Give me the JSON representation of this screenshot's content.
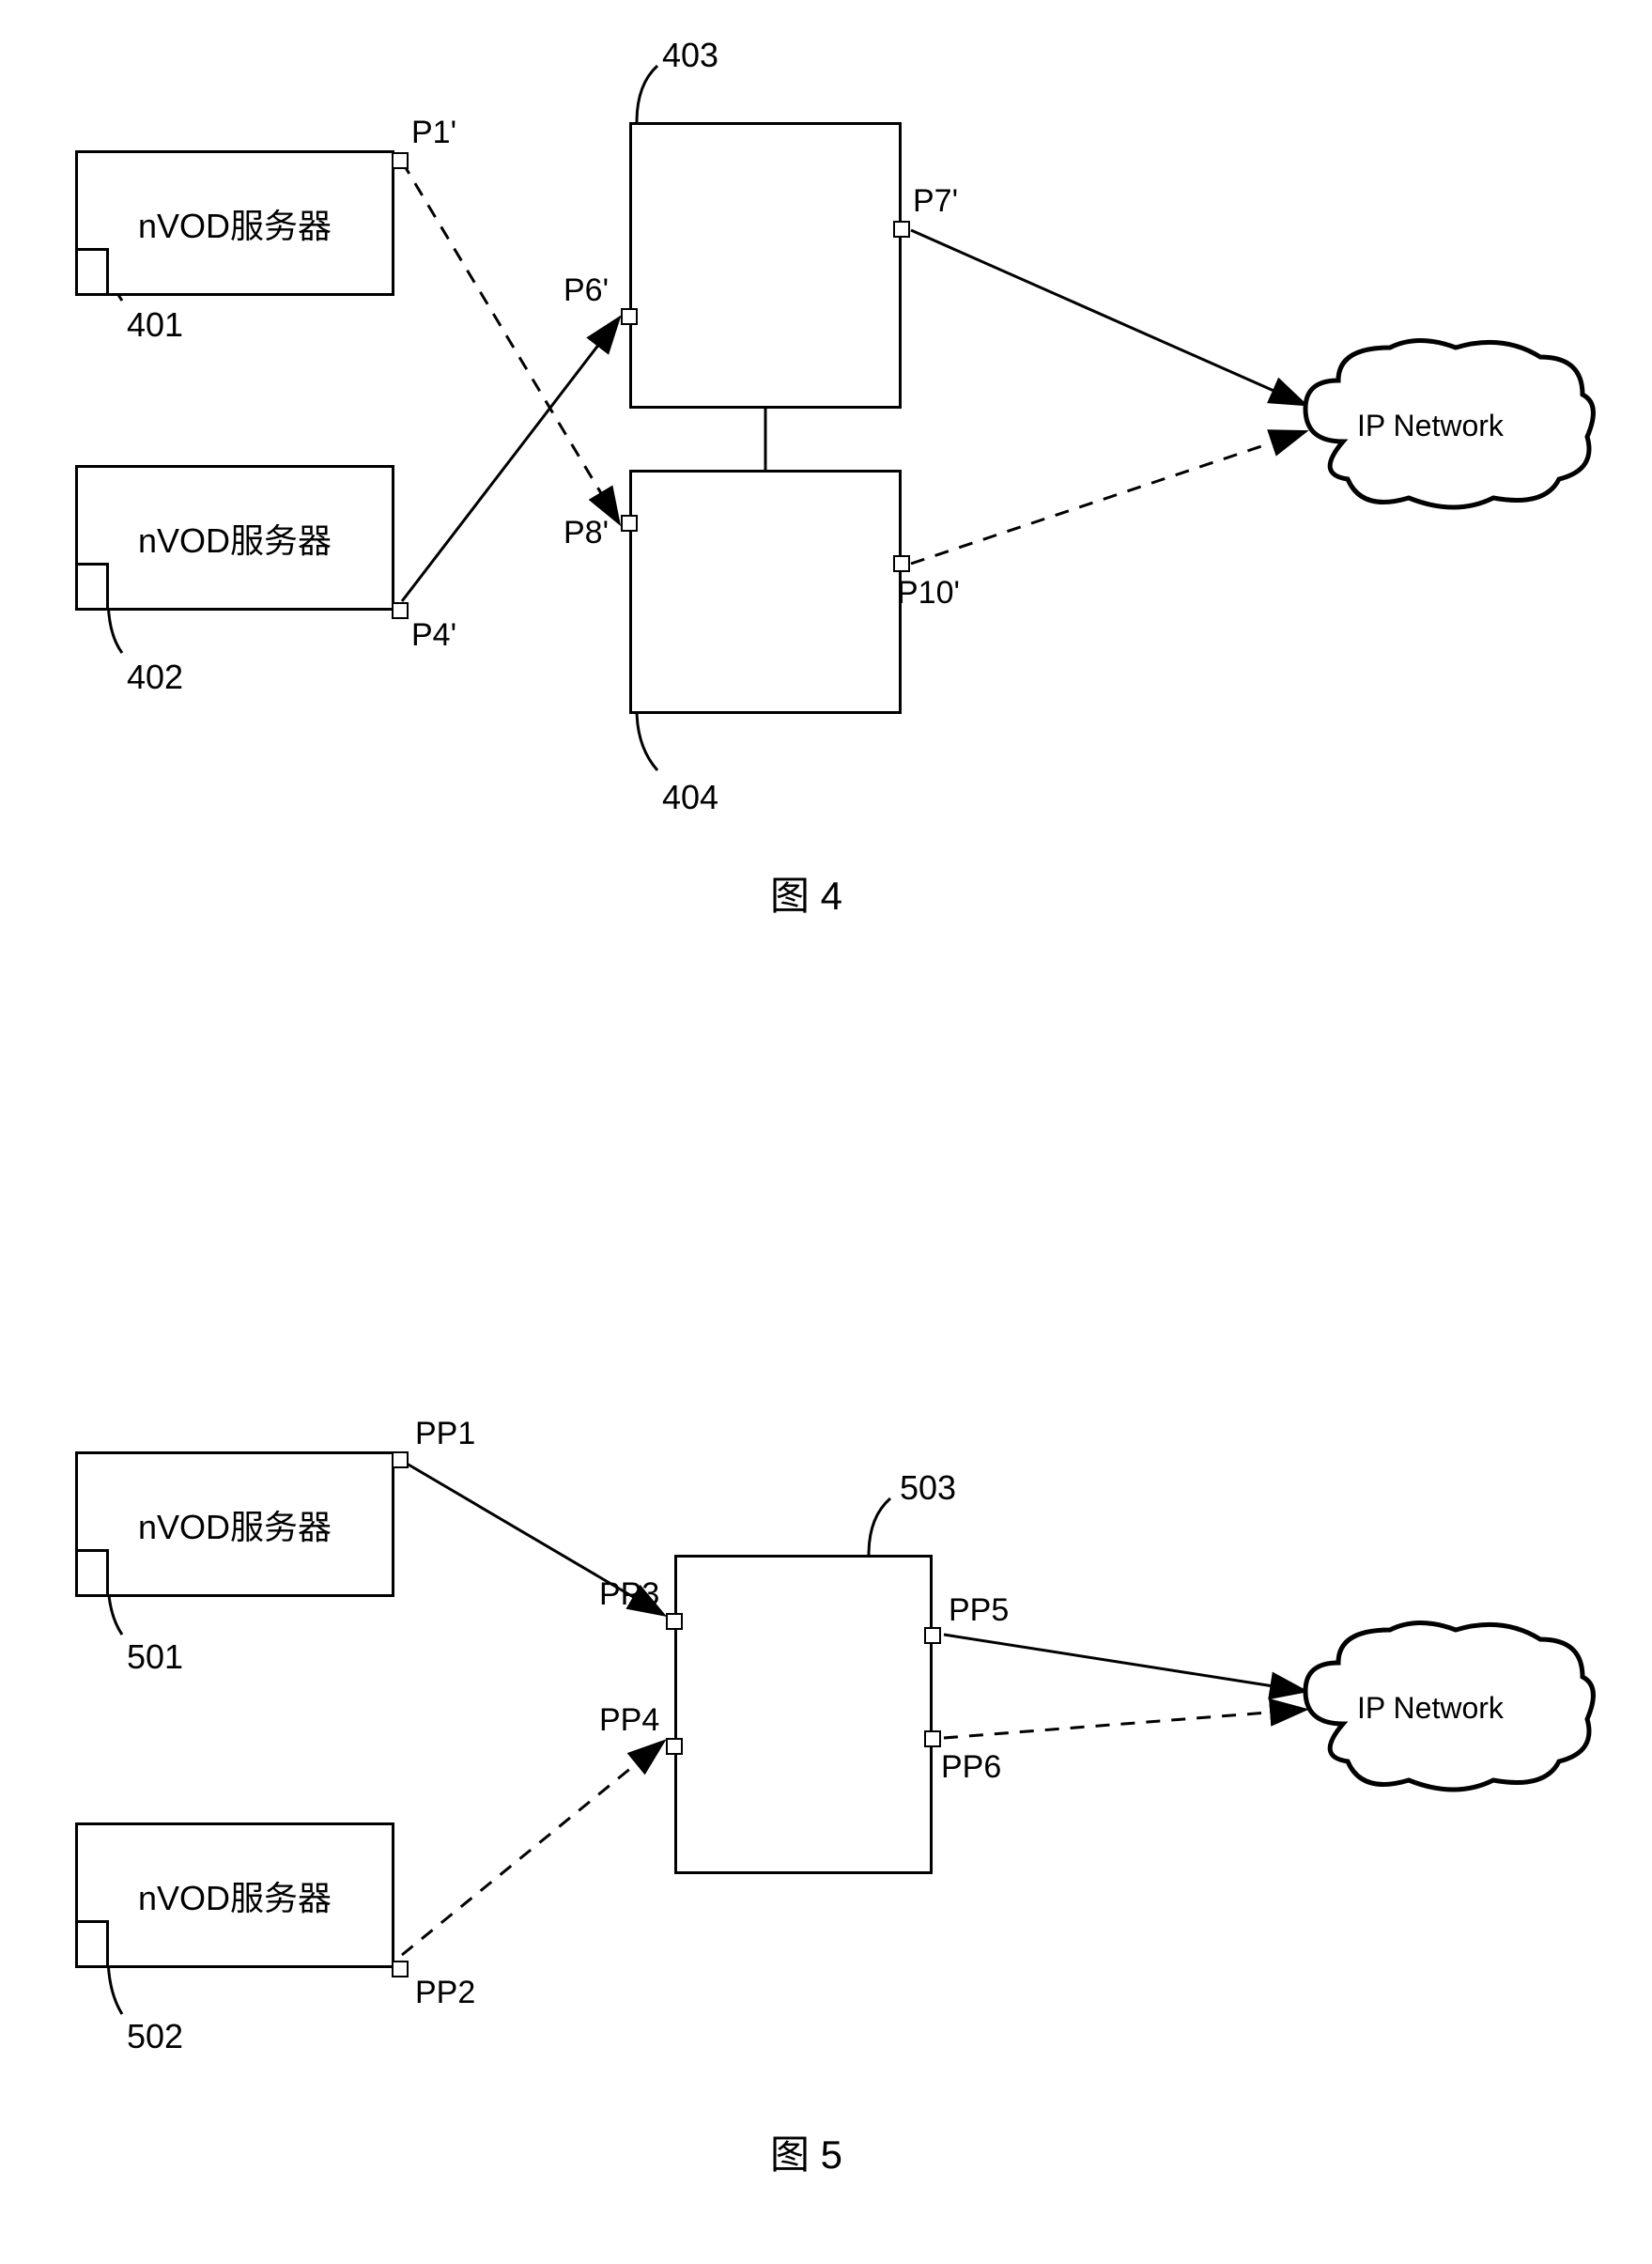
{
  "fig4": {
    "server1": {
      "label": "nVOD服务器",
      "callout": "401"
    },
    "server2": {
      "label": "nVOD服务器",
      "callout": "402"
    },
    "switch1_callout": "403",
    "switch2_callout": "404",
    "ports": {
      "p1": "P1'",
      "p4": "P4'",
      "p6": "P6'",
      "p7": "P7'",
      "p8": "P8'",
      "p10": "P10'"
    },
    "cloud": "IP Network",
    "caption": "图 4"
  },
  "fig5": {
    "server1": {
      "label": "nVOD服务器",
      "callout": "501"
    },
    "server2": {
      "label": "nVOD服务器",
      "callout": "502"
    },
    "switch_callout": "503",
    "ports": {
      "pp1": "PP1",
      "pp2": "PP2",
      "pp3": "PP3",
      "pp4": "PP4",
      "pp5": "PP5",
      "pp6": "PP6"
    },
    "cloud": "IP Network",
    "caption": "图 5"
  }
}
